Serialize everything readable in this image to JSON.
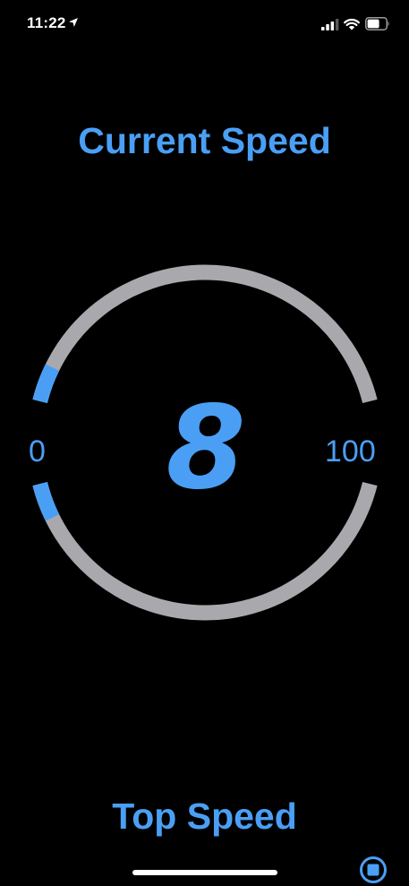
{
  "status_bar": {
    "time": "11:22"
  },
  "main": {
    "title": "Current Speed",
    "speed": "8",
    "scale_min": "0",
    "scale_max": "100",
    "speed_fraction": 0.08
  },
  "footer": {
    "title": "Top Speed"
  },
  "icons": {
    "location": "location-arrow-icon",
    "signal": "cellular-signal-icon",
    "wifi": "wifi-icon",
    "battery": "battery-icon",
    "stop": "stop-icon"
  },
  "colors": {
    "background": "#000000",
    "accent": "#4a9ff5",
    "track": "#a9a9ad"
  }
}
